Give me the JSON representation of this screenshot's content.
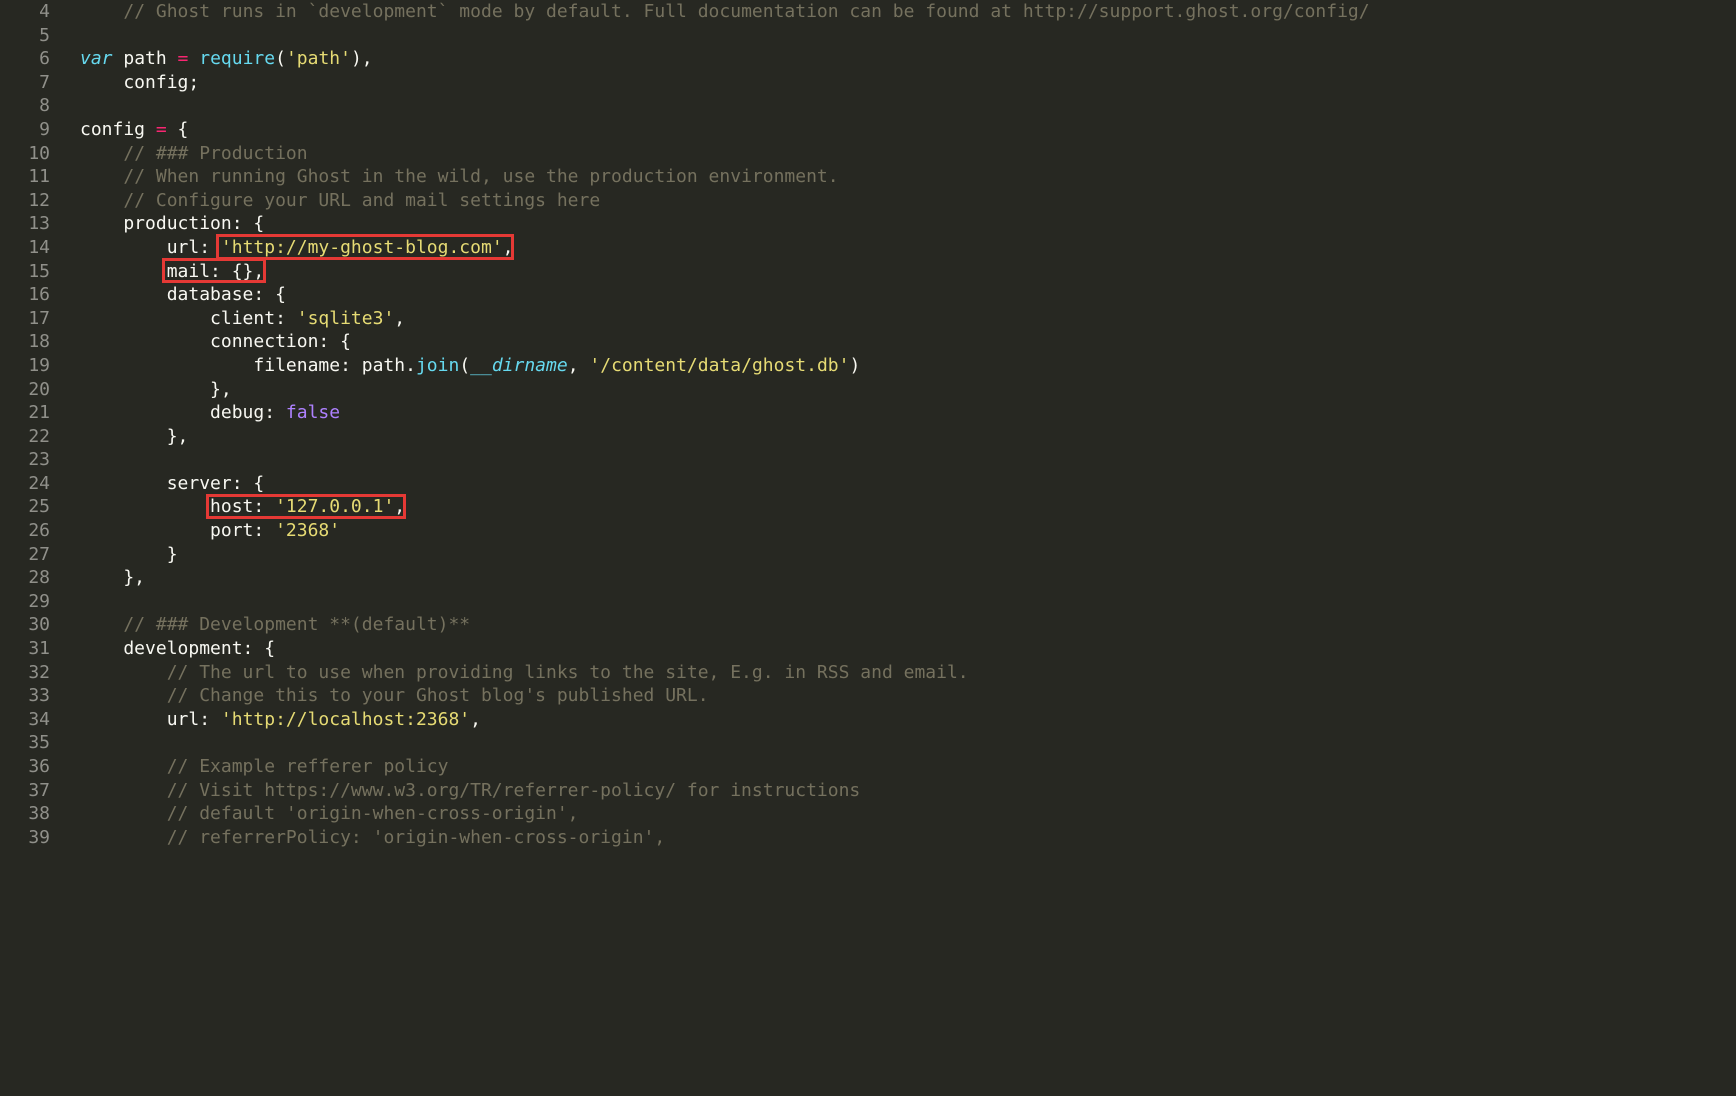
{
  "lines": [
    {
      "n": "4",
      "segs": [
        [
          "pl",
          "    "
        ],
        [
          "cm",
          "// Ghost runs in `development` mode by default. Full documentation can be found at http://support.ghost.org/config/"
        ]
      ]
    },
    {
      "n": "5",
      "segs": []
    },
    {
      "n": "6",
      "segs": [
        [
          "kw",
          "var"
        ],
        [
          "pl",
          " path "
        ],
        [
          "op",
          "="
        ],
        [
          "pl",
          " "
        ],
        [
          "fnc",
          "require"
        ],
        [
          "pl",
          "("
        ],
        [
          "st",
          "'path'"
        ],
        [
          "pl",
          "),"
        ]
      ]
    },
    {
      "n": "7",
      "segs": [
        [
          "pl",
          "    config;"
        ]
      ]
    },
    {
      "n": "8",
      "segs": []
    },
    {
      "n": "9",
      "segs": [
        [
          "pl",
          "config "
        ],
        [
          "op",
          "="
        ],
        [
          "pl",
          " {"
        ]
      ]
    },
    {
      "n": "10",
      "segs": [
        [
          "pl",
          "    "
        ],
        [
          "cm",
          "// ### Production"
        ]
      ]
    },
    {
      "n": "11",
      "segs": [
        [
          "pl",
          "    "
        ],
        [
          "cm",
          "// When running Ghost in the wild, use the production environment."
        ]
      ]
    },
    {
      "n": "12",
      "segs": [
        [
          "pl",
          "    "
        ],
        [
          "cm",
          "// Configure your URL and mail settings here"
        ]
      ]
    },
    {
      "n": "13",
      "segs": [
        [
          "pl",
          "    production: {"
        ]
      ]
    },
    {
      "n": "14",
      "segs": [
        [
          "pl",
          "        url: "
        ],
        [
          "st",
          "'http://my-ghost-blog.com'"
        ],
        [
          "pl",
          ","
        ]
      ]
    },
    {
      "n": "15",
      "segs": [
        [
          "pl",
          "        mail: {},"
        ]
      ]
    },
    {
      "n": "16",
      "segs": [
        [
          "pl",
          "        database: {"
        ]
      ]
    },
    {
      "n": "17",
      "segs": [
        [
          "pl",
          "            client: "
        ],
        [
          "st",
          "'sqlite3'"
        ],
        [
          "pl",
          ","
        ]
      ]
    },
    {
      "n": "18",
      "segs": [
        [
          "pl",
          "            connection: {"
        ]
      ]
    },
    {
      "n": "19",
      "segs": [
        [
          "pl",
          "                filename: path."
        ],
        [
          "fnc",
          "join"
        ],
        [
          "pl",
          "("
        ],
        [
          "dn",
          "__dirname"
        ],
        [
          "pl",
          ", "
        ],
        [
          "st",
          "'/content/data/ghost.db'"
        ],
        [
          "pl",
          ")"
        ]
      ]
    },
    {
      "n": "20",
      "segs": [
        [
          "pl",
          "            },"
        ]
      ]
    },
    {
      "n": "21",
      "segs": [
        [
          "pl",
          "            debug: "
        ],
        [
          "bl",
          "false"
        ]
      ]
    },
    {
      "n": "22",
      "segs": [
        [
          "pl",
          "        },"
        ]
      ]
    },
    {
      "n": "23",
      "segs": []
    },
    {
      "n": "24",
      "segs": [
        [
          "pl",
          "        server: {"
        ]
      ]
    },
    {
      "n": "25",
      "segs": [
        [
          "pl",
          "            host: "
        ],
        [
          "st",
          "'127.0.0.1'"
        ],
        [
          "pl",
          ","
        ]
      ]
    },
    {
      "n": "26",
      "segs": [
        [
          "pl",
          "            port: "
        ],
        [
          "st",
          "'2368'"
        ]
      ]
    },
    {
      "n": "27",
      "segs": [
        [
          "pl",
          "        }"
        ]
      ]
    },
    {
      "n": "28",
      "segs": [
        [
          "pl",
          "    },"
        ]
      ]
    },
    {
      "n": "29",
      "segs": []
    },
    {
      "n": "30",
      "segs": [
        [
          "pl",
          "    "
        ],
        [
          "cm",
          "// ### Development **(default)**"
        ]
      ]
    },
    {
      "n": "31",
      "segs": [
        [
          "pl",
          "    development: {"
        ]
      ]
    },
    {
      "n": "32",
      "segs": [
        [
          "pl",
          "        "
        ],
        [
          "cm",
          "// The url to use when providing links to the site, E.g. in RSS and email."
        ]
      ]
    },
    {
      "n": "33",
      "segs": [
        [
          "pl",
          "        "
        ],
        [
          "cm",
          "// Change this to your Ghost blog's published URL."
        ]
      ]
    },
    {
      "n": "34",
      "segs": [
        [
          "pl",
          "        url: "
        ],
        [
          "st",
          "'http://localhost:2368'"
        ],
        [
          "pl",
          ","
        ]
      ]
    },
    {
      "n": "35",
      "segs": []
    },
    {
      "n": "36",
      "segs": [
        [
          "pl",
          "        "
        ],
        [
          "cm",
          "// Example refferer policy"
        ]
      ]
    },
    {
      "n": "37",
      "segs": [
        [
          "pl",
          "        "
        ],
        [
          "cm",
          "// Visit https://www.w3.org/TR/referrer-policy/ for instructions"
        ]
      ]
    },
    {
      "n": "38",
      "segs": [
        [
          "pl",
          "        "
        ],
        [
          "cm",
          "// default 'origin-when-cross-origin',"
        ]
      ]
    },
    {
      "n": "39",
      "segs": [
        [
          "pl",
          "        "
        ],
        [
          "cm",
          "// referrerPolicy: 'origin-when-cross-origin',"
        ]
      ]
    }
  ],
  "highlights": [
    {
      "line": 14,
      "colStart": 13,
      "colEnd": 40
    },
    {
      "line": 15,
      "colStart": 8,
      "colEnd": 17
    },
    {
      "line": 25,
      "colStart": 12,
      "colEnd": 30
    }
  ],
  "charW": 10.8,
  "lineH": 23.6,
  "firstLine": 4,
  "codeLeft": 80
}
